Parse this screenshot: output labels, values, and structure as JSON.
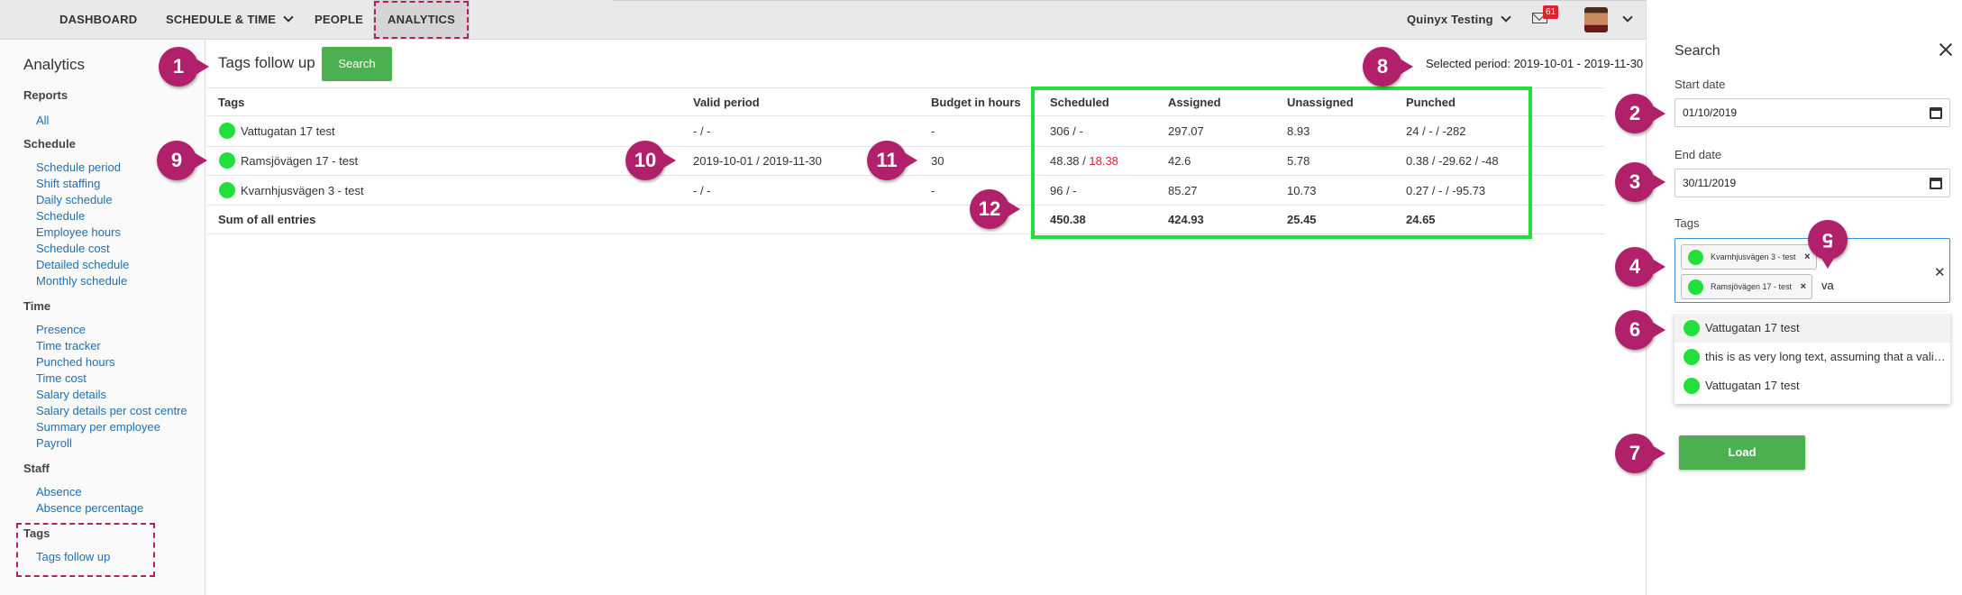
{
  "nav": {
    "items": [
      "DASHBOARD",
      "SCHEDULE & TIME",
      "PEOPLE",
      "ANALYTICS"
    ],
    "account": "Quinyx Testing",
    "mail_count": "61"
  },
  "sidebar": {
    "title": "Analytics",
    "sections": {
      "reports": "Reports",
      "schedule": "Schedule",
      "time": "Time",
      "staff": "Staff",
      "tags": "Tags"
    },
    "reports_links": [
      "All"
    ],
    "schedule_links": [
      "Schedule period",
      "Shift staffing",
      "Daily schedule",
      "Schedule",
      "Employee hours",
      "Schedule cost",
      "Detailed schedule",
      "Monthly schedule"
    ],
    "time_links": [
      "Presence",
      "Time tracker",
      "Punched hours",
      "Time cost",
      "Salary details",
      "Salary details per cost centre",
      "Summary per employee",
      "Payroll"
    ],
    "staff_links": [
      "Absence",
      "Absence percentage"
    ],
    "tags_links": [
      "Tags follow up"
    ]
  },
  "main": {
    "title": "Tags follow up",
    "search_label": "Search",
    "period": "Selected period: 2019-10-01 - 2019-11-30",
    "columns": [
      "Tags",
      "Valid period",
      "Budget in hours",
      "Scheduled",
      "Assigned",
      "Unassigned",
      "Punched"
    ],
    "rows": [
      {
        "tag": "Vattugatan 17 test",
        "period": "- / -",
        "budget": "-",
        "scheduled": "306 / -",
        "scheduled_extra": "",
        "assigned": "297.07",
        "unassigned": "8.93",
        "punched": "24 / - / -282"
      },
      {
        "tag": "Ramsjövägen 17 - test",
        "period": "2019-10-01 / 2019-11-30",
        "budget": "30",
        "scheduled": "48.38 / ",
        "scheduled_extra": "18.38",
        "assigned": "42.6",
        "unassigned": "5.78",
        "punched": "0.38 / -29.62 / -48"
      },
      {
        "tag": "Kvarnhjusvägen 3 - test",
        "period": "- / -",
        "budget": "-",
        "scheduled": "96 / -",
        "scheduled_extra": "",
        "assigned": "85.27",
        "unassigned": "10.73",
        "punched": "0.27 / - / -95.73"
      }
    ],
    "sum": {
      "label": "Sum of all entries",
      "scheduled": "450.38",
      "assigned": "424.93",
      "unassigned": "25.45",
      "punched": "24.65"
    }
  },
  "panel": {
    "title": "Search",
    "start_label": "Start date",
    "start_value": "01/10/2019",
    "end_label": "End date",
    "end_value": "30/11/2019",
    "tags_label": "Tags",
    "chips": [
      "Kvarnhjusvägen 3 - test",
      "Ramsjövägen 17 - test"
    ],
    "typed": "va",
    "options": [
      "Vattugatan 17 test",
      "this is as very long text, assuming that a vali…",
      "Vattugatan 17 test"
    ],
    "load_label": "Load"
  },
  "markers": [
    "1",
    "2",
    "3",
    "4",
    "5",
    "6",
    "7",
    "8",
    "9",
    "10",
    "11",
    "12"
  ],
  "colors": {
    "accent": "#b0206b",
    "primary_button": "#4caf50",
    "tag_dot": "#22e03a",
    "link": "#1f6fb2",
    "warning": "#d9232e"
  }
}
